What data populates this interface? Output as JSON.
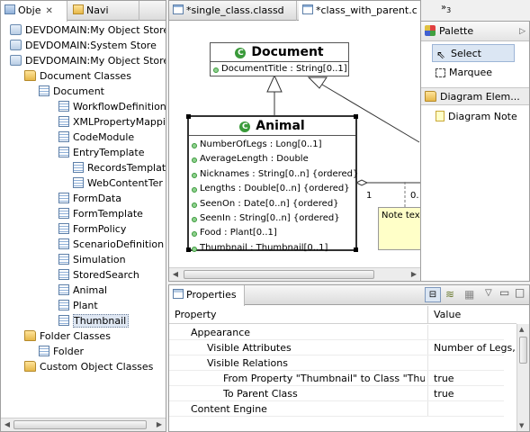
{
  "left_panel": {
    "tabs": [
      {
        "label": "Obje"
      },
      {
        "label": "Navi"
      }
    ],
    "tree": [
      {
        "label": "DEVDOMAIN:My Object Store",
        "icon": "repository-icon",
        "indent": 0
      },
      {
        "label": "DEVDOMAIN:System Store",
        "icon": "repository-icon",
        "indent": 0
      },
      {
        "label": "DEVDOMAIN:My Object Store",
        "icon": "repository-icon",
        "indent": 0
      },
      {
        "label": "Document Classes",
        "icon": "folder-icon",
        "indent": 1
      },
      {
        "label": "Document",
        "icon": "class-icon",
        "indent": 2
      },
      {
        "label": "WorkflowDefinition",
        "icon": "class-icon",
        "indent": 3
      },
      {
        "label": "XMLPropertyMappi",
        "icon": "class-icon",
        "indent": 3
      },
      {
        "label": "CodeModule",
        "icon": "class-icon",
        "indent": 3
      },
      {
        "label": "EntryTemplate",
        "icon": "class-icon",
        "indent": 3
      },
      {
        "label": "RecordsTemplat",
        "icon": "class-icon",
        "indent": 4
      },
      {
        "label": "WebContentTer",
        "icon": "class-icon",
        "indent": 4
      },
      {
        "label": "FormData",
        "icon": "class-icon",
        "indent": 3
      },
      {
        "label": "FormTemplate",
        "icon": "class-icon",
        "indent": 3
      },
      {
        "label": "FormPolicy",
        "icon": "class-icon",
        "indent": 3
      },
      {
        "label": "ScenarioDefinition",
        "icon": "class-icon",
        "indent": 3
      },
      {
        "label": "Simulation",
        "icon": "class-icon",
        "indent": 3
      },
      {
        "label": "StoredSearch",
        "icon": "class-icon",
        "indent": 3
      },
      {
        "label": "Animal",
        "icon": "class-icon",
        "indent": 3
      },
      {
        "label": "Plant",
        "icon": "class-icon",
        "indent": 3
      },
      {
        "label": "Thumbnail",
        "icon": "class-icon",
        "indent": 3,
        "selected": true
      },
      {
        "label": "Folder Classes",
        "icon": "folder-icon",
        "indent": 1
      },
      {
        "label": "Folder",
        "icon": "class-icon",
        "indent": 2
      },
      {
        "label": "Custom Object Classes",
        "icon": "folder-icon",
        "indent": 1
      }
    ]
  },
  "editor": {
    "tabs": [
      {
        "label": "*single_class.classd"
      },
      {
        "label": "*class_with_parent.c"
      }
    ],
    "overflow_count": "3",
    "document_class": {
      "name": "Document",
      "attributes": [
        "DocumentTitle : String[0..1]"
      ]
    },
    "animal_class": {
      "name": "Animal",
      "attributes": [
        "NumberOfLegs : Long[0..1]",
        "AverageLength : Double",
        "Nicknames : String[0..n] {ordered}",
        "Lengths : Double[0..n] {ordered}",
        "SeenOn : Date[0..n] {ordered}",
        "SeenIn : String[0..n] {ordered}",
        "Food : Plant[0..1]",
        "Thumbnail : Thumbnail[0..1]"
      ]
    },
    "multiplicity_left": "1",
    "multiplicity_right": "0.",
    "note_text": "Note tex"
  },
  "palette": {
    "title": "Palette",
    "tools": [
      {
        "label": "Select",
        "icon": "arrow-cursor-icon",
        "selected": true
      },
      {
        "label": "Marquee",
        "icon": "marquee-icon"
      }
    ],
    "drawer_title": "Diagram Elem...",
    "drawer_items": [
      {
        "label": "Diagram Note",
        "icon": "note-icon"
      }
    ]
  },
  "properties": {
    "tab_label": "Properties",
    "columns": [
      "Property",
      "Value"
    ],
    "rows": [
      {
        "property": "Appearance",
        "value": "",
        "indent": 1
      },
      {
        "property": "Visible Attributes",
        "value": "Number of Legs, A",
        "indent": 2
      },
      {
        "property": "Visible Relations",
        "value": "",
        "indent": 2
      },
      {
        "property": "From Property \"Thumbnail\" to Class \"Thumb",
        "value": "true",
        "indent": 3
      },
      {
        "property": "To Parent Class",
        "value": "true",
        "indent": 3
      },
      {
        "property": "Content Engine",
        "value": "",
        "indent": 1
      }
    ]
  }
}
